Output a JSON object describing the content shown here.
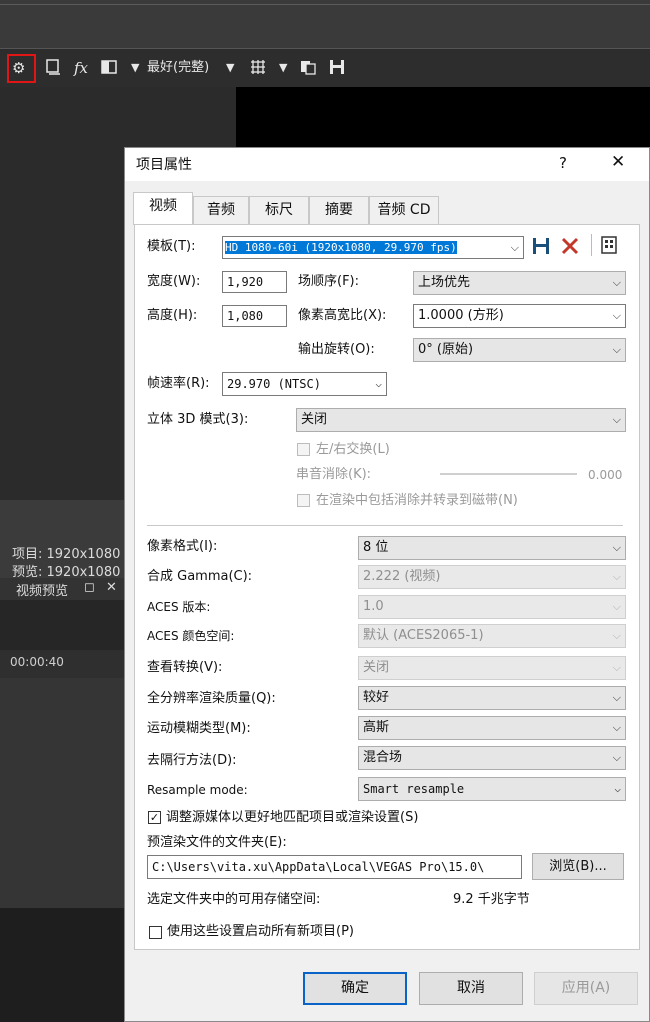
{
  "app": {
    "toolbar": {
      "fx_label": "fx",
      "quality_label": "最好(完整)",
      "dropdown_glyph": "▼"
    },
    "info": {
      "project": "项目: 1920x1080",
      "preview": "预览: 1920x1080",
      "panel_tab": "视频预览",
      "panel_tab_pin": "◻",
      "panel_tab_close": "✕"
    },
    "timeline": {
      "timecode": "00:00:40"
    },
    "accent": "#e01515"
  },
  "dialog": {
    "title": "项目属性",
    "help_label": "?",
    "close_label": "✕",
    "tabs": [
      "视频",
      "音频",
      "标尺",
      "摘要",
      "音频 CD"
    ],
    "active_tab": 0,
    "template": {
      "label": "模板(T):",
      "value": "HD 1080-60i (1920x1080, 29.970 fps)"
    },
    "width": {
      "label": "宽度(W):",
      "value": "1,920"
    },
    "height": {
      "label": "高度(H):",
      "value": "1,080"
    },
    "field_order": {
      "label": "场顺序(F):",
      "value": "上场优先"
    },
    "pixel_aspect": {
      "label": "像素高宽比(X):",
      "value": "1.0000 (方形)"
    },
    "output_rotation": {
      "label": "输出旋转(O):",
      "value": "0° (原始)"
    },
    "frame_rate": {
      "label": "帧速率(R):",
      "value": "29.970 (NTSC)"
    },
    "stereo_mode": {
      "label": "立体 3D 模式(3):",
      "value": "关闭"
    },
    "swap_lr": {
      "label": "左/右交换(L)"
    },
    "crosstalk": {
      "label": "串音消除(K):",
      "value": "0.000"
    },
    "include_render": {
      "label": "在渲染中包括消除并转录到磁带(N)"
    },
    "pixel_format": {
      "label": "像素格式(I):",
      "value": "8 位"
    },
    "compositing_gamma": {
      "label": "合成 Gamma(C):",
      "value": "2.222 (视频)"
    },
    "aces_version": {
      "label": "ACES 版本:",
      "value": "1.0"
    },
    "aces_color_space": {
      "label": "ACES 颜色空间:",
      "value": "默认 (ACES2065-1)"
    },
    "view_transform": {
      "label": "查看转换(V):",
      "value": "关闭"
    },
    "full_res_quality": {
      "label": "全分辨率渲染质量(Q):",
      "value": "较好"
    },
    "motion_blur": {
      "label": "运动模糊类型(M):",
      "value": "高斯"
    },
    "deinterlace": {
      "label": "去隔行方法(D):",
      "value": "混合场"
    },
    "resample": {
      "label": "Resample mode:",
      "value": "Smart resample"
    },
    "adjust_source": {
      "label": "调整源媒体以更好地匹配项目或渲染设置(S)",
      "checked": true,
      "mark": "✓"
    },
    "prerender_folder": {
      "label": "预渲染文件的文件夹(E):",
      "value": "C:\\Users\\vita.xu\\AppData\\Local\\VEGAS Pro\\15.0\\"
    },
    "browse_label": "浏览(B)...",
    "free_space": {
      "label": "选定文件夹中的可用存储空间:",
      "value": "9.2 千兆字节"
    },
    "start_all_new": {
      "label": "使用这些设置启动所有新项目(P)",
      "checked": false
    },
    "ok_label": "确定",
    "cancel_label": "取消",
    "apply_label": "应用(A)",
    "dropdown_glyph": "⌵"
  }
}
